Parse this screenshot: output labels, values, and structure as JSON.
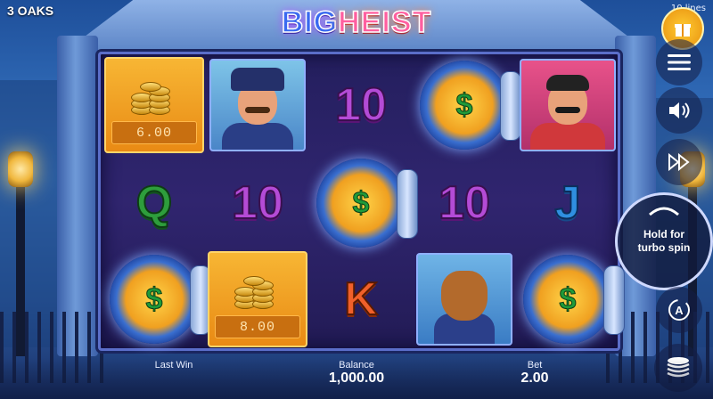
{
  "header": {
    "brand": "3 OAKS",
    "logo_big": "BIG",
    "logo_heist": "HEIST",
    "lines": "10 lines"
  },
  "reels": {
    "coin_tile_top": "6.00",
    "coin_tile_bottom": "8.00",
    "symbols": {
      "ten": "10",
      "q": "Q",
      "j": "J",
      "k": "K",
      "dollar": "$"
    }
  },
  "controls": {
    "spin_hint_line1": "Hold for",
    "spin_hint_line2": "turbo spin",
    "icons": [
      "gift-icon",
      "menu-icon",
      "sound-icon",
      "fast-forward-icon",
      "spin-icon",
      "autoplay-icon",
      "coins-icon"
    ]
  },
  "footer": {
    "last_win_label": "Last Win",
    "last_win_value": "",
    "balance_label": "Balance",
    "balance_value": "1,000.00",
    "bet_label": "Bet",
    "bet_value": "2.00"
  },
  "colors": {
    "accent": "#3a6af0",
    "heist": "#ff5fa0",
    "reel_bg": "#2a2266",
    "coin_tile": "#f0a020"
  }
}
